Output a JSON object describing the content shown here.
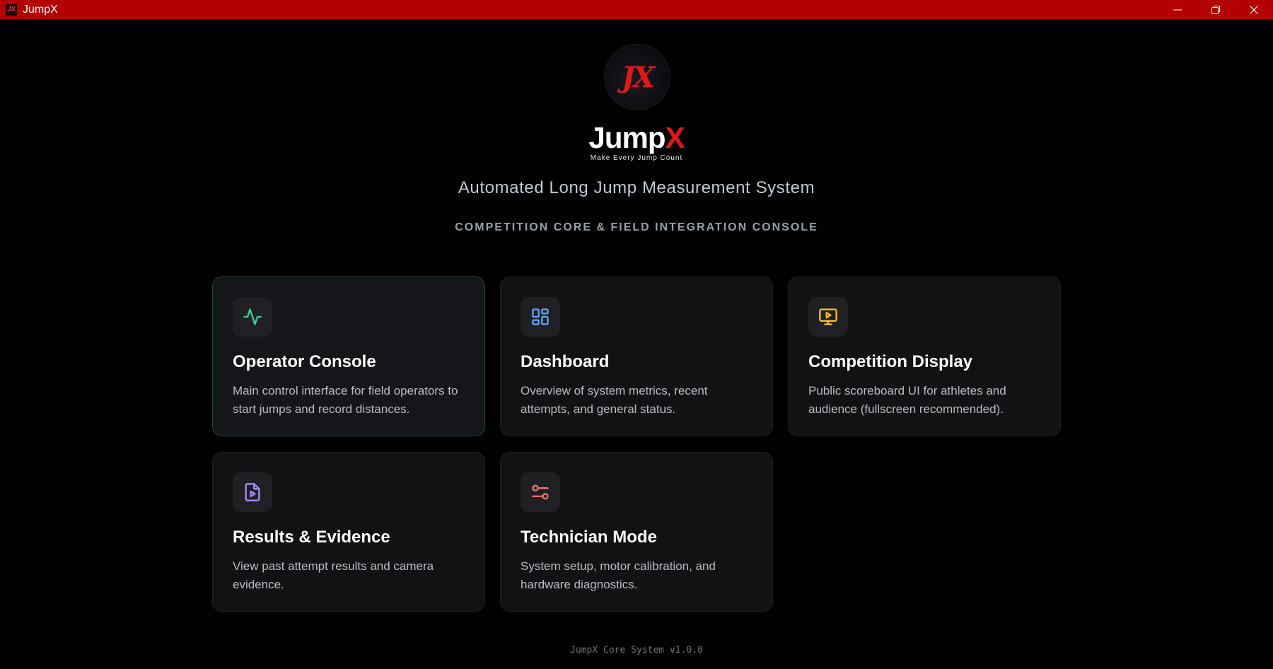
{
  "window": {
    "title": "JumpX"
  },
  "header": {
    "logo_mark": "JX",
    "brand_name_main": "Jump",
    "brand_name_accent": "X",
    "tagline": "Make Every Jump Count",
    "subtitle": "Automated Long Jump Measurement System",
    "console_label": "COMPETITION CORE & FIELD INTEGRATION CONSOLE"
  },
  "cards": [
    {
      "title": "Operator Console",
      "description": "Main control interface for field operators to start jumps and record distances.",
      "icon": "activity-icon",
      "icon_color": "#34d399",
      "active": true
    },
    {
      "title": "Dashboard",
      "description": "Overview of system metrics, recent attempts, and general status.",
      "icon": "grid-icon",
      "icon_color": "#60a5fa"
    },
    {
      "title": "Competition Display",
      "description": "Public scoreboard UI for athletes and audience (fullscreen recommended).",
      "icon": "presentation-icon",
      "icon_color": "#fbbf24"
    },
    {
      "title": "Results & Evidence",
      "description": "View past attempt results and camera evidence.",
      "icon": "file-video-icon",
      "icon_color": "#a78bfa"
    },
    {
      "title": "Technician Mode",
      "description": "System setup, motor calibration, and hardware diagnostics.",
      "icon": "sliders-icon",
      "icon_color": "#f87171"
    }
  ],
  "footer": {
    "version": "JumpX Core System v1.0.0"
  },
  "colors": {
    "titlebar": "#b30000",
    "background": "#000000",
    "card": "#121214",
    "accent_red": "#e01818"
  }
}
